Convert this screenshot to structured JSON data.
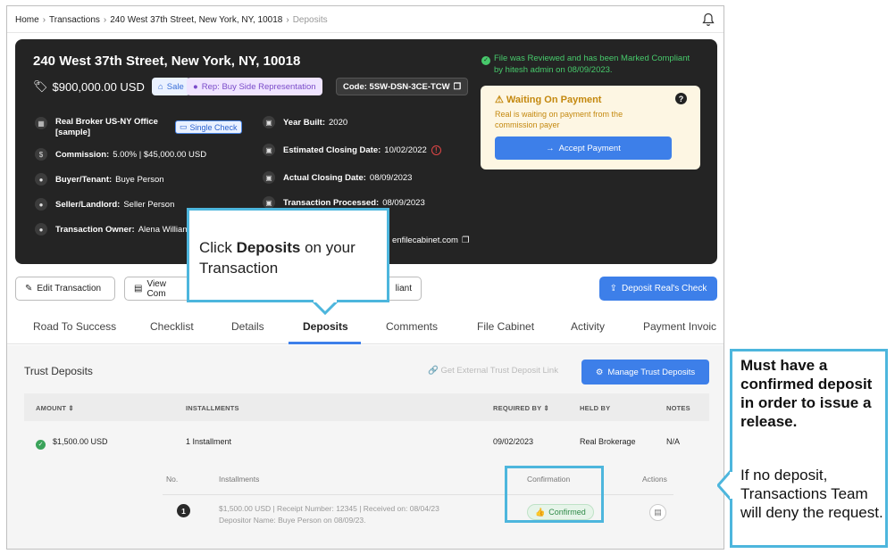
{
  "breadcrumb": {
    "home": "Home",
    "transactions": "Transactions",
    "address": "240 West 37th Street, New York, NY, 10018",
    "current": "Deposits"
  },
  "header": {
    "address": "240 West 37th Street, New York, NY, 10018",
    "price": "$900,000.00 USD",
    "sale_label": "Sale",
    "rep_label": "Rep: Buy Side Representation",
    "code_label": "Code: 5SW-DSN-3CE-TCW",
    "office_line1": "Real Broker US-NY Office",
    "office_line2": "[sample]",
    "single_check_label": "Single Check",
    "commission_label": "Commission:",
    "commission_value": "5.00% | $45,000.00 USD",
    "buyer_label": "Buyer/Tenant:",
    "buyer_value": "Buye Person",
    "seller_label": "Seller/Landlord:",
    "seller_value": "Seller Person",
    "owner_label": "Transaction Owner:",
    "owner_value": "Alena Williams",
    "year_built_label": "Year Built:",
    "year_built_value": "2020",
    "est_closing_label": "Estimated Closing Date:",
    "est_closing_value": "10/02/2022",
    "actual_closing_label": "Actual Closing Date:",
    "actual_closing_value": "08/09/2023",
    "processed_label": "Transaction Processed:",
    "processed_value": "08/09/2023",
    "email_fragment": "enfilecabinet.com"
  },
  "compliance": {
    "line1": "File was Reviewed and has been Marked Compliant",
    "line2": "by hitesh admin on 08/09/2023."
  },
  "waiting": {
    "title": "Waiting On Payment",
    "description": "Real is waiting on payment from the commission payer",
    "accept_label": "Accept Payment"
  },
  "actions": {
    "edit_label": "Edit Transaction",
    "view_label": "View Com",
    "compliant_label": "liant",
    "deposit_label": "Deposit Real's Check"
  },
  "tabs": [
    "Road To Success",
    "Checklist",
    "Details",
    "Deposits",
    "Comments",
    "File Cabinet",
    "Activity",
    "Payment Invoic"
  ],
  "trust": {
    "title": "Trust Deposits",
    "external_link": "Get External Trust Deposit Link",
    "manage_label": "Manage Trust Deposits",
    "columns": [
      "AMOUNT",
      "INSTALLMENTS",
      "REQUIRED BY",
      "HELD BY",
      "NOTES"
    ],
    "row": {
      "amount": "$1,500.00 USD",
      "installments": "1 Installment",
      "required_by": "09/02/2023",
      "held_by": "Real Brokerage",
      "notes": "N/A"
    },
    "sub_columns": [
      "No.",
      "Installments",
      "Confirmation",
      "Actions"
    ],
    "sub_row": {
      "number": "1",
      "line1": "$1,500.00 USD | Receipt Number: 12345 | Received on: 08/04/23",
      "line2": "Depositor Name: Buye Person on 08/09/23.",
      "status": "Confirmed"
    }
  },
  "callout": {
    "pre": "Click ",
    "bold": "Deposits",
    "post": " on your Transaction"
  },
  "note": {
    "bold": "Must have a confirmed deposit in order to issue a release.",
    "plain": "If no deposit, Transactions Team will deny the request."
  },
  "colors": {
    "accent": "#3d7fe9",
    "callout_border": "#4db6dd",
    "card_bg": "#242424",
    "success": "#47c96b"
  }
}
